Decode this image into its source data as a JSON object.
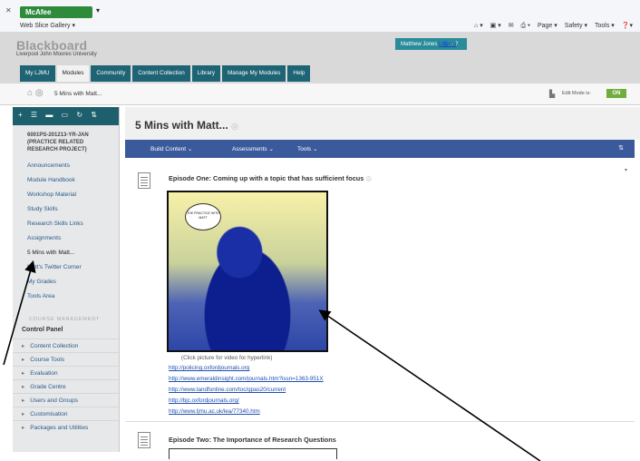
{
  "browser": {
    "mcafee_label": "McAfee",
    "web_slice": "Web Slice Gallery ▾",
    "tools": [
      "Page ▾",
      "Safety ▾",
      "Tools ▾"
    ]
  },
  "header": {
    "logo": "Blackboard",
    "university": "Liverpool John Moores University",
    "user": "Matthew Jones",
    "logout": "Logout",
    "tabs": [
      "My LJMU",
      "Modules",
      "Community",
      "Content Collection",
      "Library",
      "Manage My Modules",
      "Help"
    ]
  },
  "breadcrumb": {
    "page": "5 Mins with Matt...",
    "edit_mode_label": "Edit Mode is:",
    "edit_mode_value": "ON"
  },
  "sidebar": {
    "course_title": "6001PS-201213-YR-JAN (PRACTICE RELATED RESEARCH PROJECT)",
    "items": [
      "Announcements",
      "Module Handbook",
      "Workshop Material",
      "Study Skills",
      "Research Skills Links",
      "Assignments",
      "5 Mins with Matt...",
      "Matt's Twitter Corner",
      "My Grades",
      "Tools Area"
    ],
    "course_management_label": "COURSE MANAGEMENT",
    "control_panel": "Control Panel",
    "panel_items": [
      "Content Collection",
      "Course Tools",
      "Evaluation",
      "Grade Centre",
      "Users and Groups",
      "Customisation",
      "Packages and Utilities"
    ]
  },
  "main": {
    "title": "5 Mins with Matt...",
    "actions": [
      "Build Content ⌄",
      "Assessments ⌄",
      "Tools ⌄"
    ],
    "episode1_title": "Episode One: Coming up with a topic that has sufficient focus",
    "speech_text": "THE PRACTICE WITH MATT",
    "caption": "(Click picture for video for hyperlink)",
    "links": [
      "http://policing.oxfordjournals.org",
      "http://www.emeraldinsight.com/journals.htm?issn=1363-951X",
      "http://www.tandfonline.com/toc/gpas20/current",
      "http://bjc.oxfordjournals.org/",
      "http://www.ljmu.ac.uk/lea/77340.htm"
    ],
    "episode2_title": "Episode Two: The Importance of Research Questions"
  }
}
